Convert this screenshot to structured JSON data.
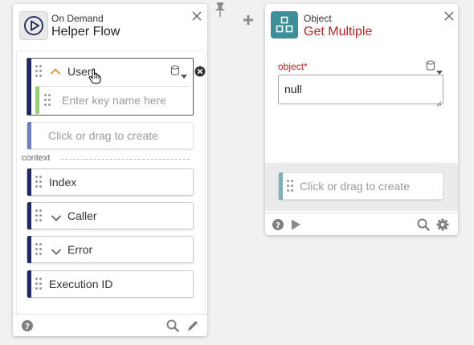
{
  "left_card": {
    "subtitle": "On Demand",
    "title": "Helper Flow",
    "close_label": "×",
    "user_pill": {
      "label": "User"
    },
    "key_input": {
      "placeholder": "Enter key name here"
    },
    "create_slot": {
      "label": "Click or drag to create"
    },
    "context_label": "context",
    "context_items": [
      {
        "label": "Index"
      },
      {
        "label": "Caller"
      },
      {
        "label": "Error"
      },
      {
        "label": "Execution ID"
      }
    ]
  },
  "right_card": {
    "subtitle": "Object",
    "title": "Get Multiple",
    "close_label": "×",
    "field_label": "object*",
    "field_value": "null",
    "create_slot": {
      "label": "Click or drag to create"
    }
  },
  "colors": {
    "navy_bar": "#1f2a5c",
    "green_bar": "#9cce7b",
    "slot_bar": "#6e80b5",
    "teal_bar": "#7fb0b5",
    "teal_icon": "#3e8e98",
    "red_title": "#b32424",
    "chevron_orange": "#e08a2c"
  },
  "icons": {
    "pin": "pin-icon",
    "plus": "plus-icon",
    "flow": "play-circle-icon",
    "object": "grid-blocks-icon",
    "db": "database-icon",
    "help": "help-icon",
    "search": "search-icon",
    "edit": "pencil-icon",
    "run": "play-icon",
    "settings": "gear-icon",
    "remove": "remove-circle-icon",
    "cursor": "hand-cursor-icon"
  }
}
